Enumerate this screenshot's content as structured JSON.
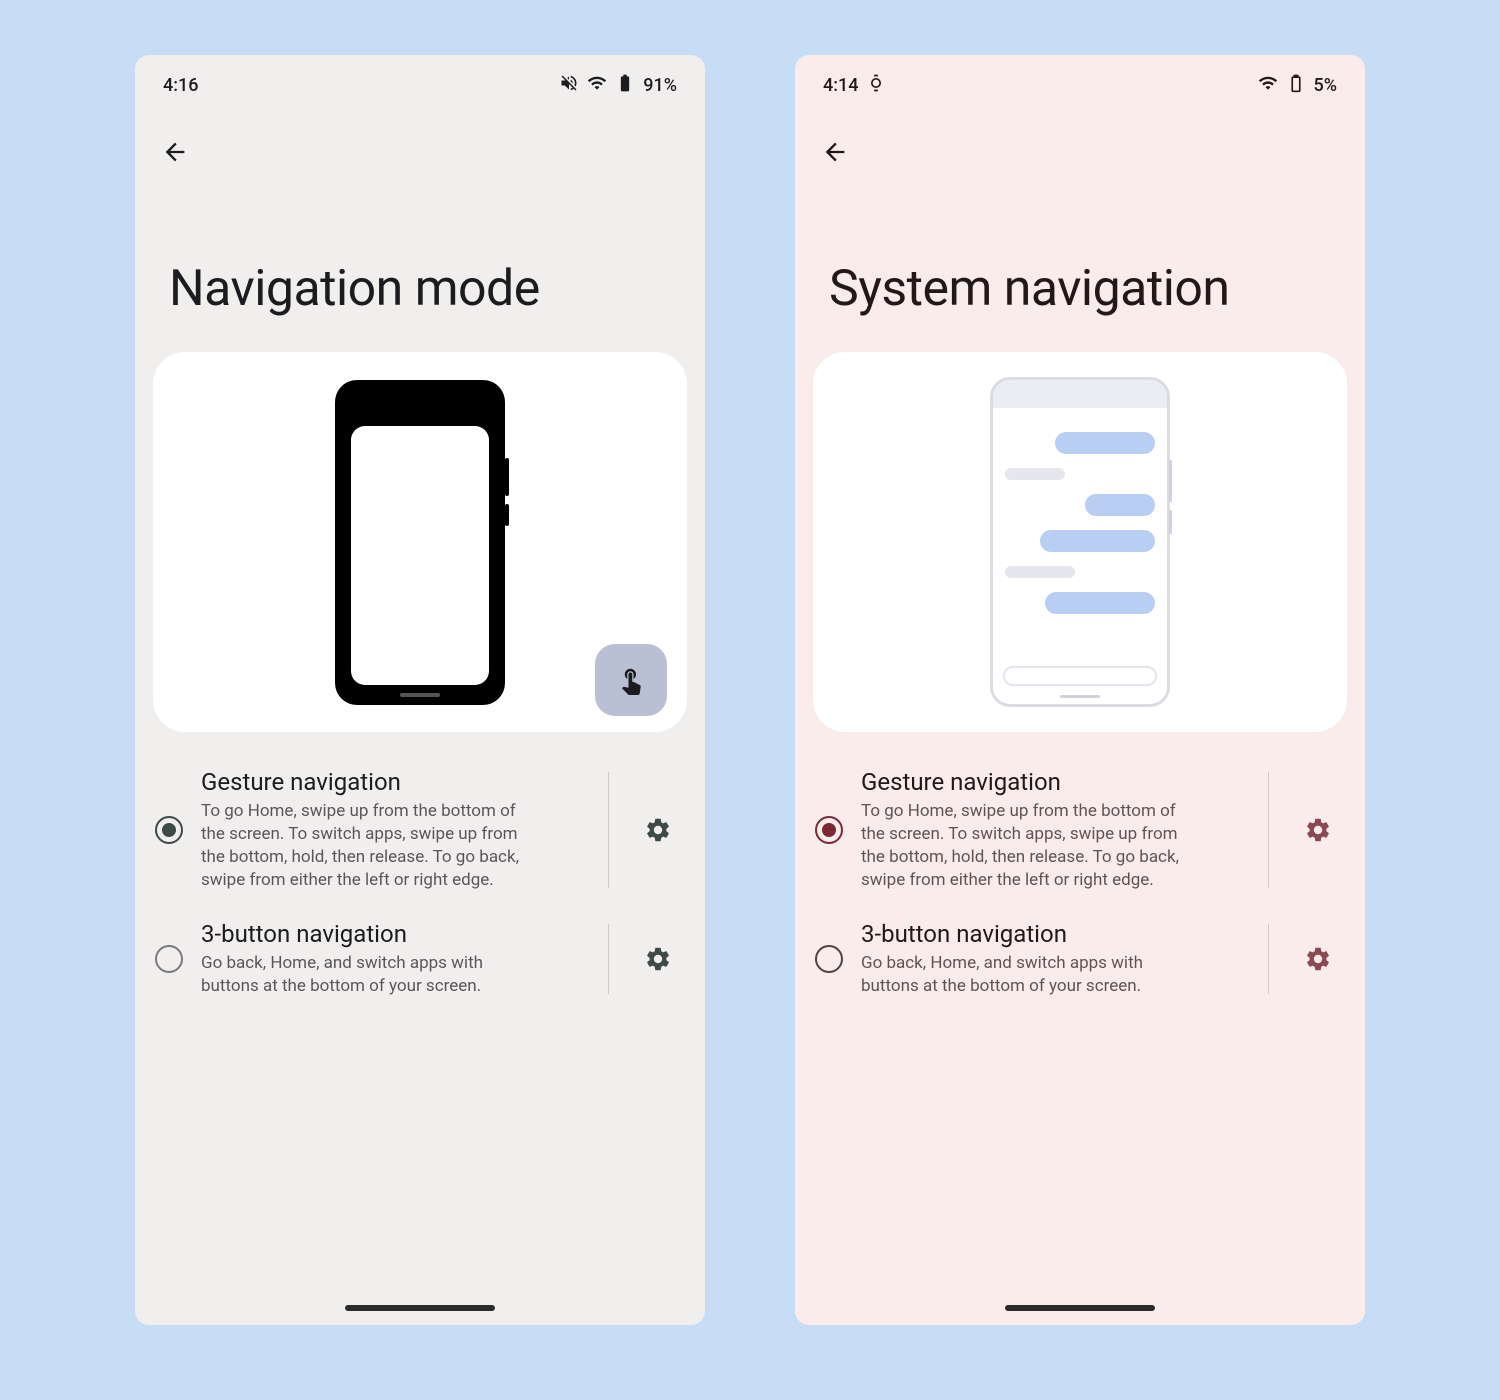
{
  "left": {
    "status": {
      "time": "4:16",
      "battery": "91%"
    },
    "title": "Navigation mode",
    "options": [
      {
        "title": "Gesture navigation",
        "desc": "To go Home, swipe up from the bottom of the screen. To switch apps, swipe up from the bottom, hold, then release. To go back, swipe from either the left or right edge.",
        "selected": true
      },
      {
        "title": "3-button navigation",
        "desc": "Go back, Home, and switch apps with buttons at the bottom of your screen.",
        "selected": false
      }
    ]
  },
  "right": {
    "status": {
      "time": "4:14",
      "battery": "5%"
    },
    "title": "System navigation",
    "options": [
      {
        "title": "Gesture navigation",
        "desc": "To go Home, swipe up from the bottom of the screen. To switch apps, swipe up from the bottom, hold, then release. To go back, swipe from either the left or right edge.",
        "selected": true
      },
      {
        "title": "3-button navigation",
        "desc": "Go back, Home, and switch apps with buttons at the bottom of your screen.",
        "selected": false
      }
    ]
  }
}
